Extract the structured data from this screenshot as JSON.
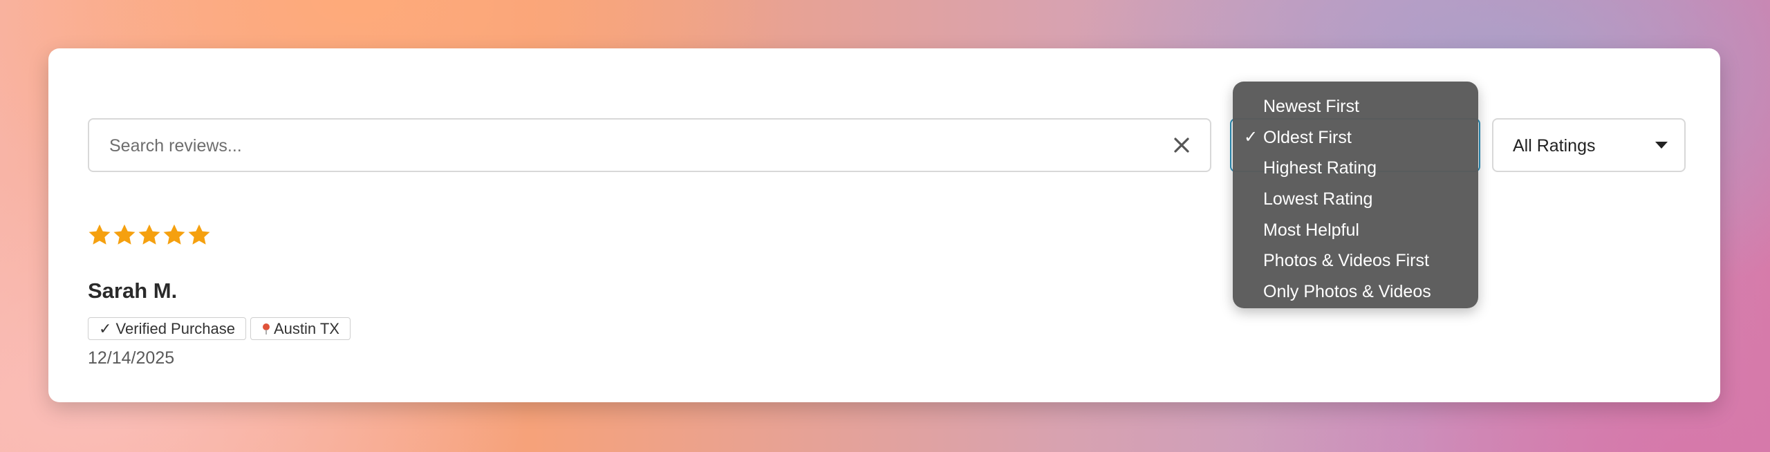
{
  "search": {
    "placeholder": "Search reviews...",
    "value": ""
  },
  "sort": {
    "options": [
      {
        "label": "Newest First",
        "selected": false
      },
      {
        "label": "Oldest First",
        "selected": true
      },
      {
        "label": "Highest Rating",
        "selected": false
      },
      {
        "label": "Lowest Rating",
        "selected": false
      },
      {
        "label": "Most Helpful",
        "selected": false
      },
      {
        "label": "Photos & Videos First",
        "selected": false
      },
      {
        "label": "Only Photos & Videos",
        "selected": false
      }
    ],
    "check_mark": "✓"
  },
  "rating_filter": {
    "selected": "All Ratings"
  },
  "review": {
    "rating": 5,
    "rating_max": 5,
    "reviewer": "Sarah M.",
    "verified_label": "✓ Verified Purchase",
    "location_icon": "pin-icon",
    "location": "Austin TX",
    "date": "12/14/2025"
  },
  "colors": {
    "star": "#f5a00f",
    "accent_border": "#2a8fb8",
    "dropdown_bg": "#5a5a5a",
    "location_pin": "#e0533a"
  }
}
